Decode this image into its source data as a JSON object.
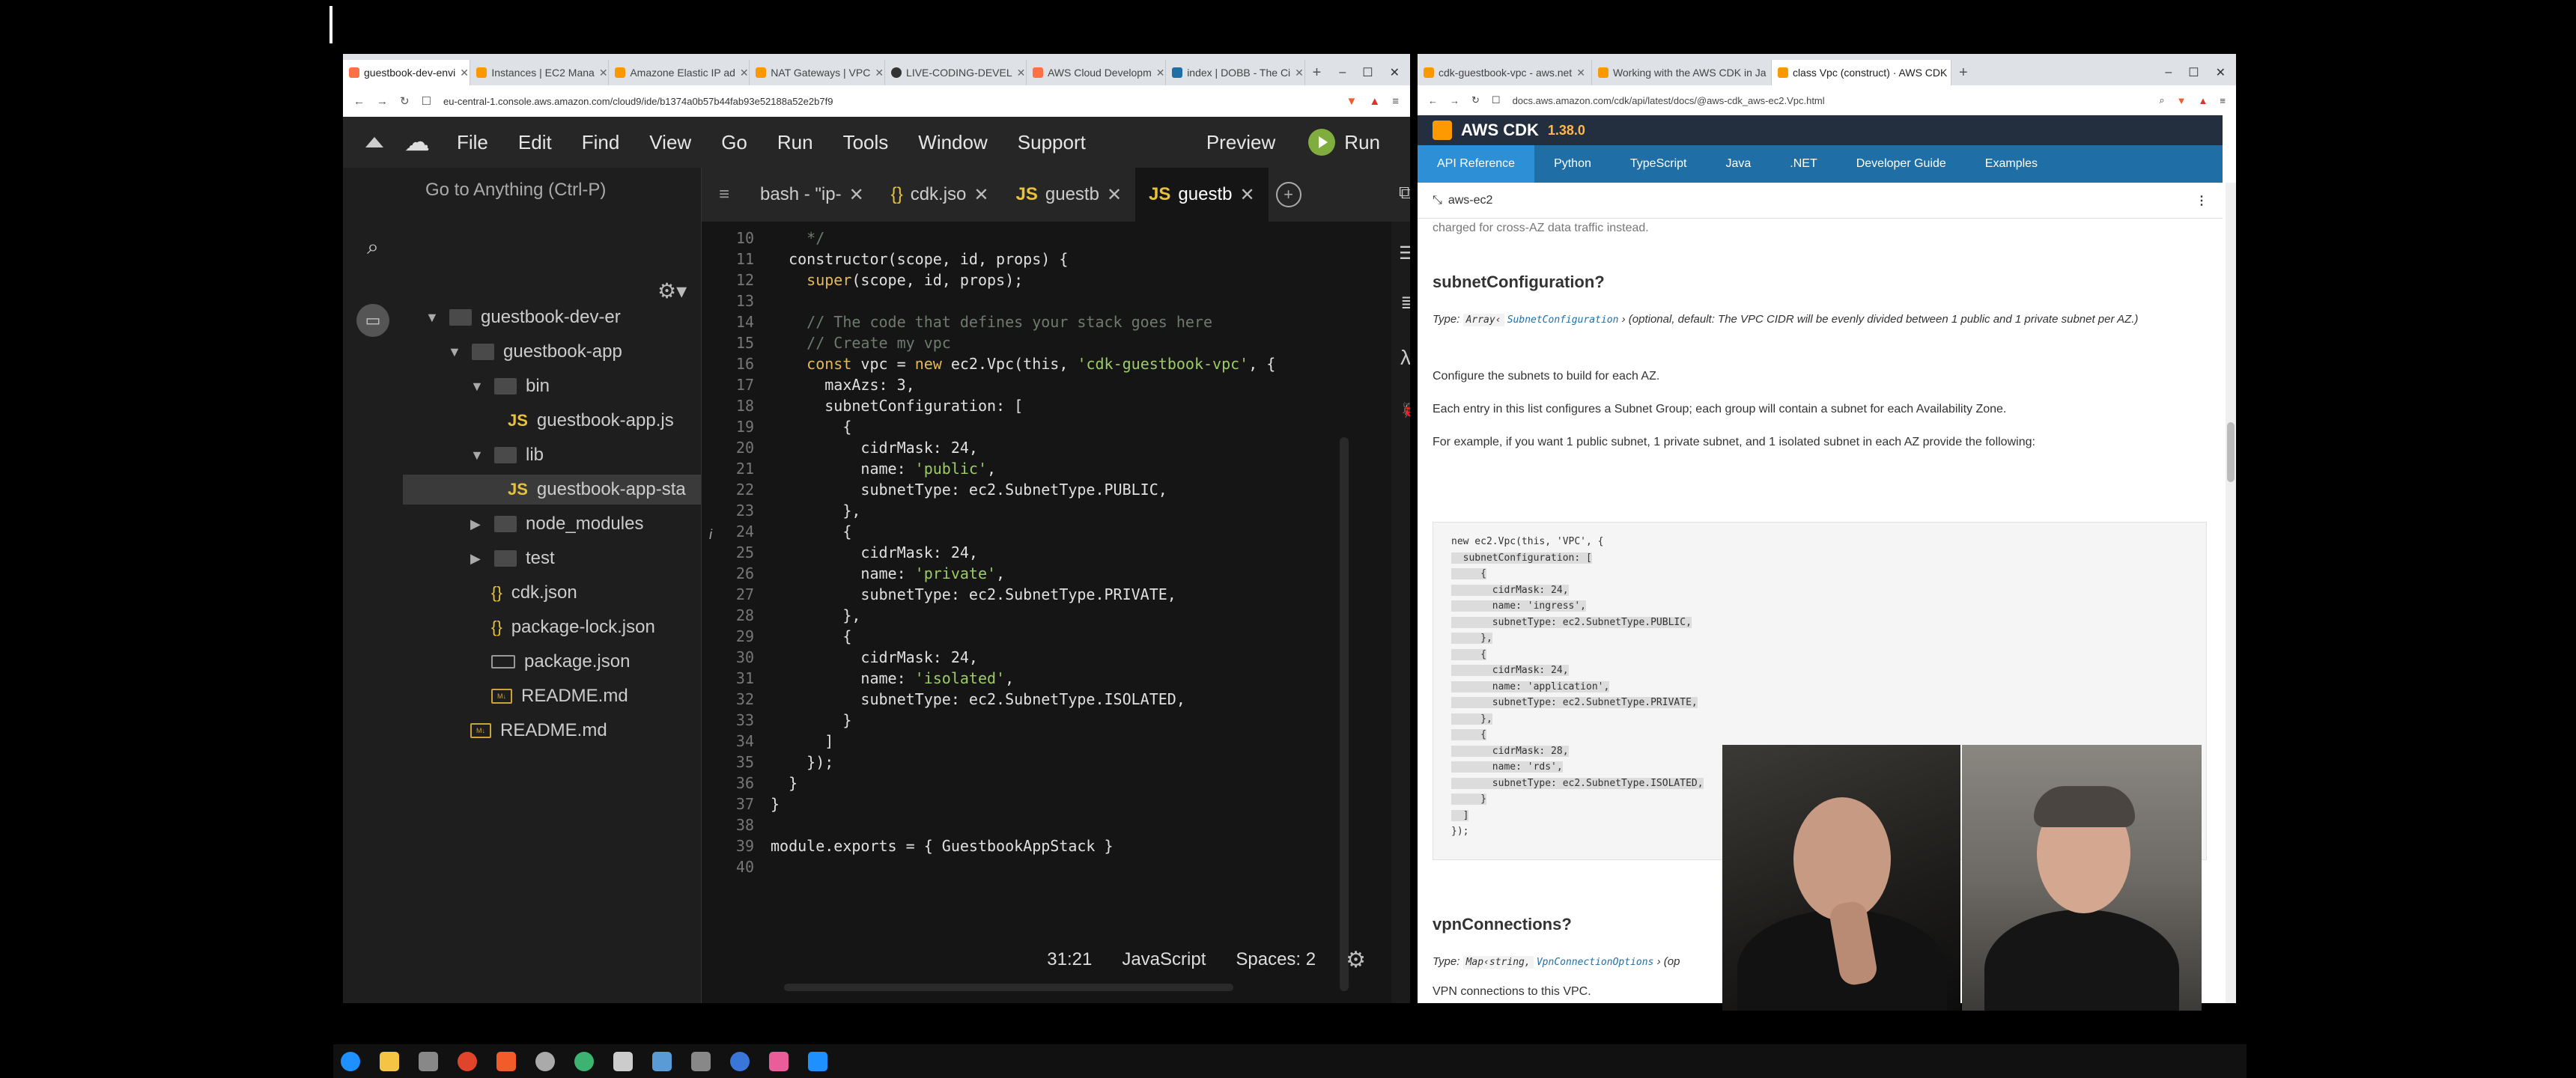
{
  "left_browser": {
    "tabs": [
      {
        "label": "guestbook-dev-envi",
        "color": "#ff7043",
        "active": true
      },
      {
        "label": "Instances | EC2 Mana",
        "color": "#ff9800"
      },
      {
        "label": "Amazone Elastic IP ad",
        "color": "#ff9800"
      },
      {
        "label": "NAT Gateways | VPC",
        "color": "#ff9800"
      },
      {
        "label": "LIVE-CODING-DEVEL",
        "color": "#333333"
      },
      {
        "label": "AWS Cloud Developm",
        "color": "#ff7043"
      },
      {
        "label": "index | DOBB - The Ci",
        "color": "#1f6fa6"
      }
    ],
    "url": "eu-central-1.console.aws.amazon.com/cloud9/ide/b1374a0b57b44fab93e52188a52e2b7f9"
  },
  "c9_menu": {
    "items": [
      "File",
      "Edit",
      "Find",
      "View",
      "Go",
      "Run",
      "Tools",
      "Window",
      "Support"
    ],
    "preview": "Preview",
    "run": "Run"
  },
  "tree": {
    "goto": "Go to Anything (Ctrl-P)",
    "items": [
      {
        "label": "guestbook-dev-er"
      },
      {
        "label": "guestbook-app"
      },
      {
        "label": "bin"
      },
      {
        "label": "guestbook-app.js"
      },
      {
        "label": "lib"
      },
      {
        "label": "guestbook-app-sta"
      },
      {
        "label": "node_modules"
      },
      {
        "label": "test"
      },
      {
        "label": "cdk.json"
      },
      {
        "label": "package-lock.json"
      },
      {
        "label": "package.json"
      },
      {
        "label": "README.md"
      },
      {
        "label": "README.md"
      }
    ]
  },
  "editor": {
    "tabs": [
      {
        "label": "bash - \"ip-"
      },
      {
        "label": "cdk.jso"
      },
      {
        "label": "guestb"
      },
      {
        "label": "guestb"
      }
    ],
    "lines": [
      {
        "n": "10",
        "text": "    */"
      },
      {
        "n": "11",
        "text": "  constructor(scope, id, props) {"
      },
      {
        "n": "12",
        "text": "    super(scope, id, props);"
      },
      {
        "n": "13",
        "text": ""
      },
      {
        "n": "14",
        "text": "    // The code that defines your stack goes here"
      },
      {
        "n": "15",
        "text": "    // Create my vpc"
      },
      {
        "n": "16",
        "text": "    const vpc = new ec2.Vpc(this, 'cdk-guestbook-vpc', {"
      },
      {
        "n": "17",
        "text": "      maxAzs: 3,"
      },
      {
        "n": "18",
        "text": "      subnetConfiguration: ["
      },
      {
        "n": "19",
        "text": "        {"
      },
      {
        "n": "20",
        "text": "          cidrMask: 24,"
      },
      {
        "n": "21",
        "text": "          name: 'public',"
      },
      {
        "n": "22",
        "text": "          subnetType: ec2.SubnetType.PUBLIC,"
      },
      {
        "n": "23",
        "text": "        },"
      },
      {
        "n": "24",
        "text": "        {"
      },
      {
        "n": "25",
        "text": "          cidrMask: 24,"
      },
      {
        "n": "26",
        "text": "          name: 'private',"
      },
      {
        "n": "27",
        "text": "          subnetType: ec2.SubnetType.PRIVATE,"
      },
      {
        "n": "28",
        "text": "        },"
      },
      {
        "n": "29",
        "text": "        {"
      },
      {
        "n": "30",
        "text": "          cidrMask: 24,"
      },
      {
        "n": "31",
        "text": "          name: 'isolated',"
      },
      {
        "n": "32",
        "text": "          subnetType: ec2.SubnetType.ISOLATED,"
      },
      {
        "n": "33",
        "text": "        }"
      },
      {
        "n": "34",
        "text": "      ]"
      },
      {
        "n": "35",
        "text": "    });"
      },
      {
        "n": "36",
        "text": "  }"
      },
      {
        "n": "37",
        "text": "}"
      },
      {
        "n": "38",
        "text": ""
      },
      {
        "n": "39",
        "text": "module.exports = { GuestbookAppStack }"
      },
      {
        "n": "40",
        "text": ""
      }
    ],
    "status": {
      "position": "31:21",
      "language": "JavaScript",
      "spaces": "Spaces: 2"
    }
  },
  "right_browser": {
    "tabs": [
      {
        "label": "cdk-guestbook-vpc - aws.net",
        "color": "#ff9800"
      },
      {
        "label": "Working with the AWS CDK in Ja",
        "color": "#ff9800"
      },
      {
        "label": "class Vpc (construct) · AWS CDK",
        "color": "#ff9800",
        "active": true
      }
    ],
    "url": "docs.aws.amazon.com/cdk/api/latest/docs/@aws-cdk_aws-ec2.Vpc.html",
    "header": {
      "title": "AWS CDK",
      "version": "1.38.0"
    },
    "nav": [
      "API Reference",
      "Python",
      "TypeScript",
      "Java",
      ".NET",
      "Developer Guide",
      "Examples"
    ],
    "crumb": "aws-ec2",
    "clipped_top": "charged for cross-AZ data traffic instead.",
    "section1_title": "subnetConfiguration?",
    "type_label": "Type:",
    "type_array": "Array‹",
    "type_link": "SubnetConfiguration",
    "type_close": "›",
    "type_desc": "(optional, default: The VPC CIDR will be evenly divided between 1 public and 1 private subnet per AZ.)",
    "p1": "Configure the subnets to build for each AZ.",
    "p2": "Each entry in this list configures a Subnet Group; each group will contain a subnet for each Availability Zone.",
    "p3": "For example, if you want 1 public subnet, 1 private subnet, and 1 isolated subnet in each AZ provide the following:",
    "code": [
      "new ec2.Vpc(this, 'VPC', {",
      "  subnetConfiguration: [",
      "     {",
      "       cidrMask: 24,",
      "       name: 'ingress',",
      "       subnetType: ec2.SubnetType.PUBLIC,",
      "     },",
      "     {",
      "       cidrMask: 24,",
      "       name: 'application',",
      "       subnetType: ec2.SubnetType.PRIVATE,",
      "     },",
      "     {",
      "       cidrMask: 28,",
      "       name: 'rds',",
      "       subnetType: ec2.SubnetType.ISOLATED,",
      "     }",
      "  ]",
      "});"
    ],
    "section2_title": "vpnConnections?",
    "type2_chip": "Map‹string,",
    "type2_link": "VpnConnectionOptions",
    "type2_rest": "› (op",
    "p4": "VPN connections to this VPC."
  }
}
